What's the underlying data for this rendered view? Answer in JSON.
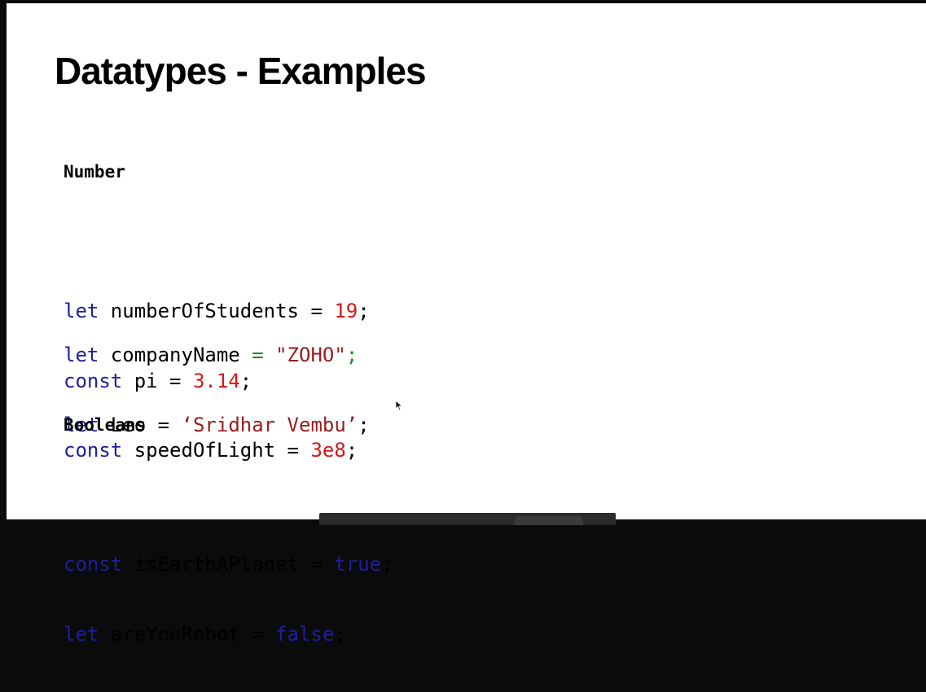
{
  "slide": {
    "title": "Datatypes - Examples",
    "sections": {
      "number_heading": "Number",
      "booleans_heading": "Booleans"
    },
    "code": {
      "l1": {
        "kw": "let",
        "rest": " numberOfStudents = ",
        "val": "19",
        "end": ";"
      },
      "l2": {
        "kw": "const",
        "rest": " pi = ",
        "val": "3.14",
        "end": ";"
      },
      "l3": {
        "kw": "const",
        "rest": " speedOfLight = ",
        "val": "3e8",
        "end": ";"
      },
      "l4": {
        "kw": "let",
        "rest": " companyName ",
        "eq": "=",
        "sp": " ",
        "val": "\"ZOHO\"",
        "end": ";"
      },
      "l5": {
        "kw": "let",
        "rest": " Leo = ",
        "val": "‘Sridhar Vembu’",
        "end": ";"
      },
      "l6": {
        "kw": "const",
        "rest": " isEarthAPlanet = ",
        "val": "true",
        "end": ";"
      },
      "l7": {
        "kw": "let",
        "rest": " areYouRobot = ",
        "val": "false",
        "end": ";"
      }
    }
  },
  "colors": {
    "keyword": "#1d1e9c",
    "number": "#d41818",
    "string": "#9c1c1c",
    "operator_green": "#1e8a1e",
    "background": "#ffffff"
  },
  "icons": [
    "mouse-pointer-icon"
  ]
}
